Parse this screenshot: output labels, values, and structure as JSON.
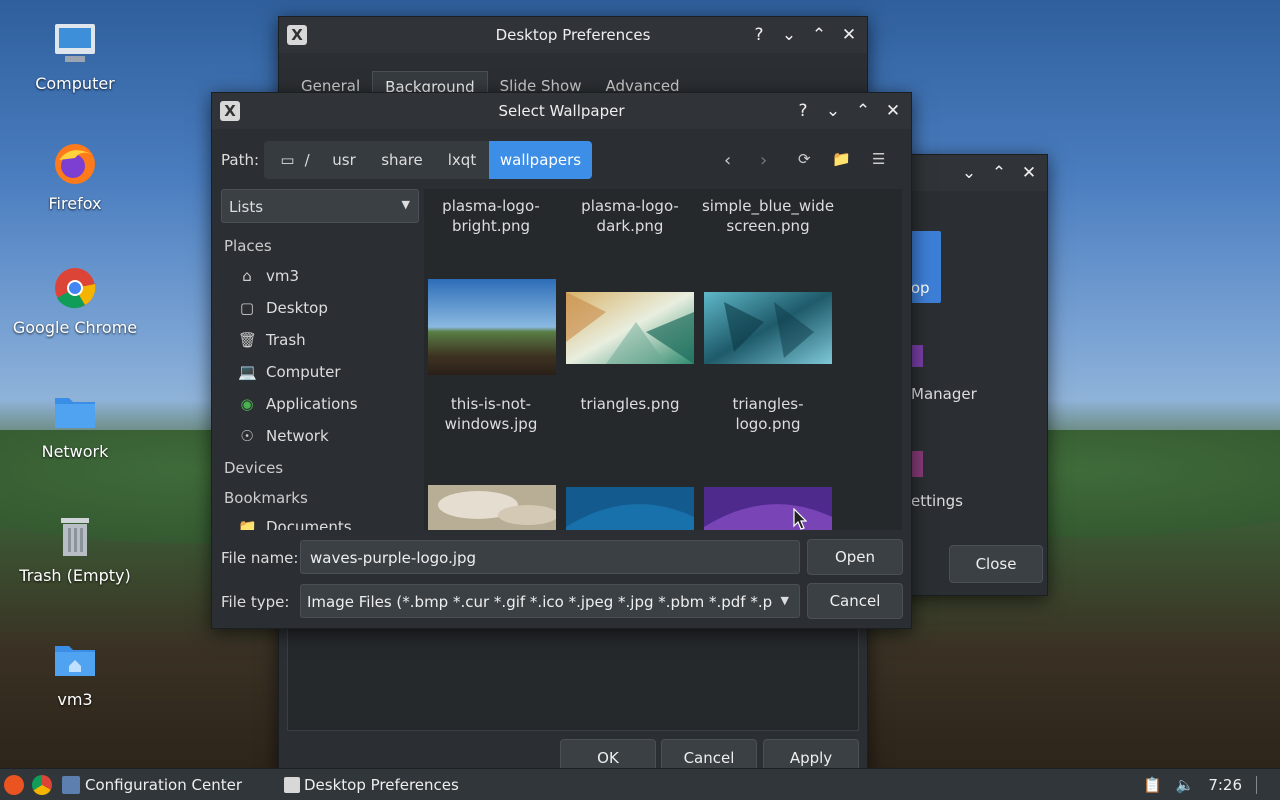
{
  "desktop": {
    "icons": [
      {
        "label": "Computer"
      },
      {
        "label": "Firefox"
      },
      {
        "label": "Google Chrome"
      },
      {
        "label": "Network"
      },
      {
        "label": "Trash (Empty)"
      },
      {
        "label": "vm3"
      }
    ]
  },
  "prefs_window": {
    "title": "Desktop Preferences",
    "tabs": [
      "General",
      "Background",
      "Slide Show",
      "Advanced"
    ],
    "buttons": {
      "ok": "OK",
      "cancel": "Cancel",
      "apply": "Apply"
    }
  },
  "config_window": {
    "items": [
      "top",
      "Manager",
      "ettings"
    ],
    "close_label": "Close"
  },
  "dialog": {
    "title": "Select Wallpaper",
    "path_label": "Path:",
    "breadcrumbs": [
      "/",
      "usr",
      "share",
      "lxqt",
      "wallpapers"
    ],
    "view_mode": "Lists",
    "sections": {
      "places": "Places",
      "devices": "Devices",
      "bookmarks": "Bookmarks"
    },
    "places": [
      "vm3",
      "Desktop",
      "Trash",
      "Computer",
      "Applications",
      "Network"
    ],
    "bookmarks": [
      "Documents"
    ],
    "files_row1": [
      "plasma-logo-\nbright.png",
      "plasma-logo-\ndark.png",
      "simple_blue_wide\nscreen.png"
    ],
    "files_row2": [
      "this-is-not-\nwindows.jpg",
      "triangles.png",
      "triangles-\nlogo.png"
    ],
    "file_name_label": "File name:",
    "file_name_value": "waves-purple-logo.jpg",
    "file_type_label": "File type:",
    "file_type_value": "Image Files (*.bmp *.cur *.gif *.ico *.jpeg *.jpg *.pbm *.pdf *.pgm",
    "open_label": "Open",
    "cancel_label": "Cancel"
  },
  "taskbar": {
    "tasks": [
      "Configuration Center",
      "Desktop Preferences"
    ],
    "clock": "7:26"
  }
}
